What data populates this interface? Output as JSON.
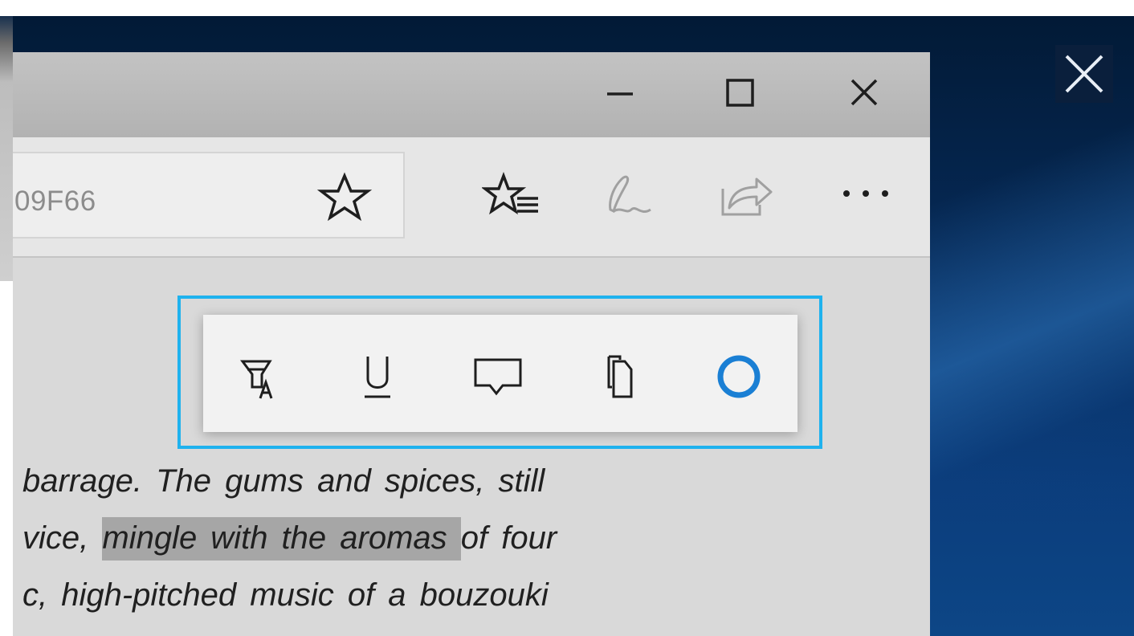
{
  "address_bar": {
    "url_fragment": "09F66"
  },
  "article": {
    "lines": [
      {
        "before": "barrage. ",
        "highlight": "",
        "after": "The gums and spices, still"
      },
      {
        "before": "vice, ",
        "highlight": "mingle with the aromas ",
        "after": "of four"
      },
      {
        "before": "c, high-pitched music of a bouzouki",
        "highlight": "",
        "after": ""
      }
    ]
  },
  "context_menu": {
    "items": [
      {
        "icon": "highlight-text-icon"
      },
      {
        "icon": "underline-icon"
      },
      {
        "icon": "comment-icon"
      },
      {
        "icon": "copy-icon"
      },
      {
        "icon": "cortana-icon"
      }
    ]
  },
  "colors": {
    "focus_outline": "#1fb2ee",
    "cortana": "#1a7fd4",
    "desktop_background": "#062a58",
    "selection_highlight": "#a6a6a6"
  }
}
